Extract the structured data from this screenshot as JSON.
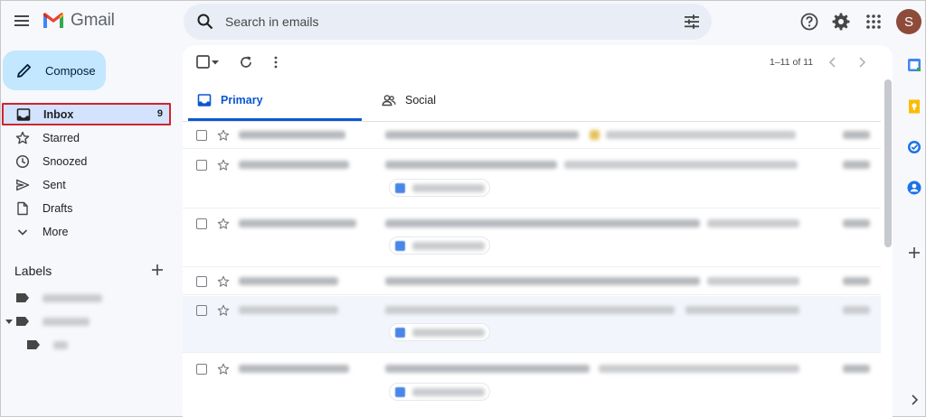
{
  "app": {
    "name": "Gmail"
  },
  "search": {
    "placeholder": "Search in emails"
  },
  "user": {
    "initial": "S"
  },
  "compose": {
    "label": "Compose"
  },
  "nav": {
    "inbox": {
      "label": "Inbox",
      "count": "9"
    },
    "starred": "Starred",
    "snoozed": "Snoozed",
    "sent": "Sent",
    "drafts": "Drafts",
    "more": "More"
  },
  "labels": {
    "title": "Labels"
  },
  "toolbar": {
    "pager": "1–11 of 11"
  },
  "tabs": {
    "primary": "Primary",
    "social": "Social"
  },
  "colors": {
    "accent": "#0b57d0",
    "compose_bg": "#c2e7ff",
    "selected_nav": "#d3e3fd",
    "highlight_box": "#d1242f"
  }
}
